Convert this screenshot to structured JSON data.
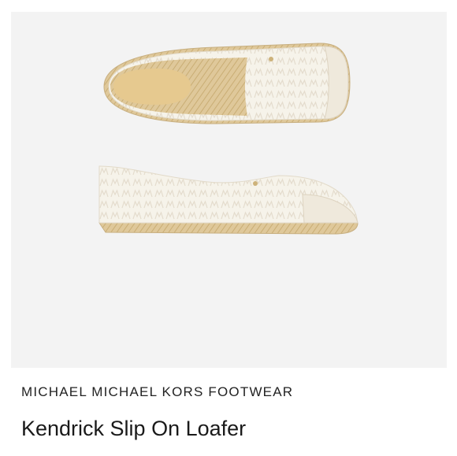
{
  "product": {
    "brand": "MICHAEL MICHAEL KORS FOOTWEAR",
    "name": "Kendrick Slip On Loafer"
  },
  "image": {
    "description_icon": "product-photo",
    "background_color": "#f3f3f3",
    "shoe_color": "#f6f3ea",
    "pattern_color": "#e7e0d2",
    "jute_color": "#dcc494",
    "insole_color": "#e6c98f"
  }
}
